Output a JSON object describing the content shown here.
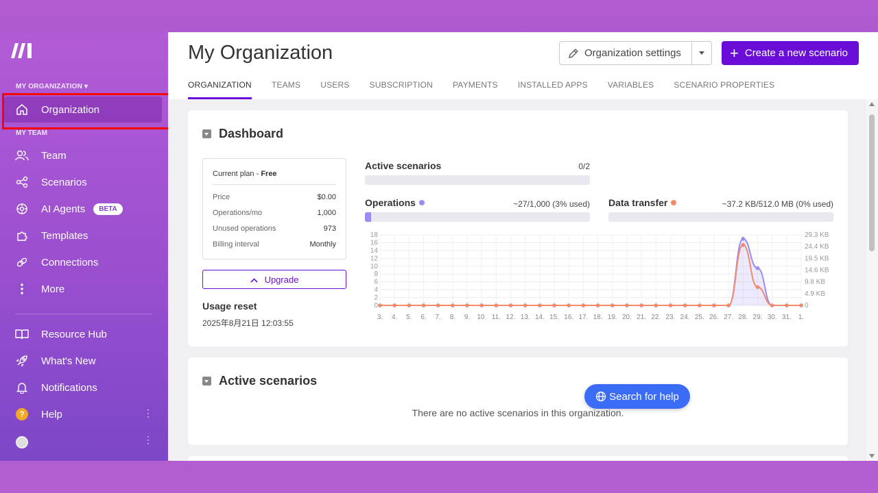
{
  "sidebar": {
    "org_label": "MY ORGANIZATION ▾",
    "team_label": "MY TEAM",
    "items": [
      {
        "label": "Organization",
        "icon": "home-icon"
      },
      {
        "label": "Team",
        "icon": "users-icon"
      },
      {
        "label": "Scenarios",
        "icon": "share-icon"
      },
      {
        "label": "AI Agents",
        "icon": "agent-icon",
        "badge": "BETA"
      },
      {
        "label": "Templates",
        "icon": "puzzle-icon"
      },
      {
        "label": "Connections",
        "icon": "link-icon"
      },
      {
        "label": "More",
        "icon": "more-vertical-icon"
      },
      {
        "label": "Resource Hub",
        "icon": "book-icon"
      },
      {
        "label": "What's New",
        "icon": "rocket-icon"
      },
      {
        "label": "Notifications",
        "icon": "bell-icon"
      },
      {
        "label": "Help",
        "icon": "help-icon",
        "icon_text": "?"
      }
    ],
    "kebab": "⋮"
  },
  "header": {
    "title": "My Organization",
    "settings_label": "Organization settings",
    "create_label": "Create a new scenario",
    "create_plus": "+"
  },
  "tabs": [
    "ORGANIZATION",
    "TEAMS",
    "USERS",
    "SUBSCRIPTION",
    "PAYMENTS",
    "INSTALLED APPS",
    "VARIABLES",
    "SCENARIO PROPERTIES"
  ],
  "dashboard": {
    "title": "Dashboard",
    "plan": {
      "head_prefix": "Current plan - ",
      "head_value": "Free",
      "rows": [
        {
          "label": "Price",
          "value": "$0.00"
        },
        {
          "label": "Operations/mo",
          "value": "1,000"
        },
        {
          "label": "Unused operations",
          "value": "973"
        },
        {
          "label": "Billing interval",
          "value": "Monthly"
        }
      ]
    },
    "upgrade_label": "Upgrade",
    "upgrade_icon": "^",
    "usage_reset_title": "Usage reset",
    "usage_reset_date": "2025年8月21日 12:03:55",
    "active_scenarios": {
      "label": "Active scenarios",
      "value": "0/2",
      "fraction": 0
    },
    "operations": {
      "label": "Operations",
      "value": "~27/1,000 (3% used)",
      "fraction": 0.027,
      "color": "#9b8cf5"
    },
    "data_transfer": {
      "label": "Data transfer",
      "value": "~37.2 KB/512.0 MB (0% used)",
      "fraction": 0,
      "color": "#f28a6e"
    }
  },
  "chart_data": {
    "type": "line",
    "categories": [
      "3.",
      "4.",
      "5.",
      "6.",
      "7.",
      "8.",
      "9.",
      "10.",
      "11.",
      "12.",
      "13.",
      "14.",
      "15.",
      "16.",
      "17.",
      "18.",
      "19.",
      "20.",
      "21.",
      "22.",
      "23.",
      "24.",
      "25.",
      "26.",
      "27.",
      "28.",
      "29.",
      "30.",
      "31.",
      "1."
    ],
    "y_left_ticks": [
      "0",
      "2",
      "4",
      "6",
      "8",
      "10",
      "12",
      "14",
      "16",
      "18"
    ],
    "y_right_ticks": [
      "0",
      "4.9 KB",
      "9.8 KB",
      "14.6 KB",
      "19.5 KB",
      "24.4 KB",
      "29.3 KB"
    ],
    "ylim_left": [
      0,
      18
    ],
    "ylim_right_kb": [
      0,
      29.3
    ],
    "series": [
      {
        "name": "Operations",
        "color": "#9b8cf5",
        "axis": "left",
        "values": [
          0,
          0,
          0,
          0,
          0,
          0,
          0,
          0,
          0,
          0,
          0,
          0,
          0,
          0,
          0,
          0,
          0,
          0,
          0,
          0,
          0,
          0,
          0,
          0,
          0,
          17,
          9.5,
          0,
          0,
          0
        ]
      },
      {
        "name": "Data transfer",
        "color": "#f28a6e",
        "axis": "right",
        "values": [
          0,
          0,
          0,
          0,
          0,
          0,
          0,
          0,
          0,
          0,
          0,
          0,
          0,
          0,
          0,
          0,
          0,
          0,
          0,
          0,
          0,
          0,
          0,
          0,
          0,
          25.1,
          7.6,
          0,
          0,
          0
        ]
      }
    ]
  },
  "active_section": {
    "title": "Active scenarios",
    "empty_message": "There are no active scenarios in this organization."
  },
  "search_help_label": "Search for help"
}
